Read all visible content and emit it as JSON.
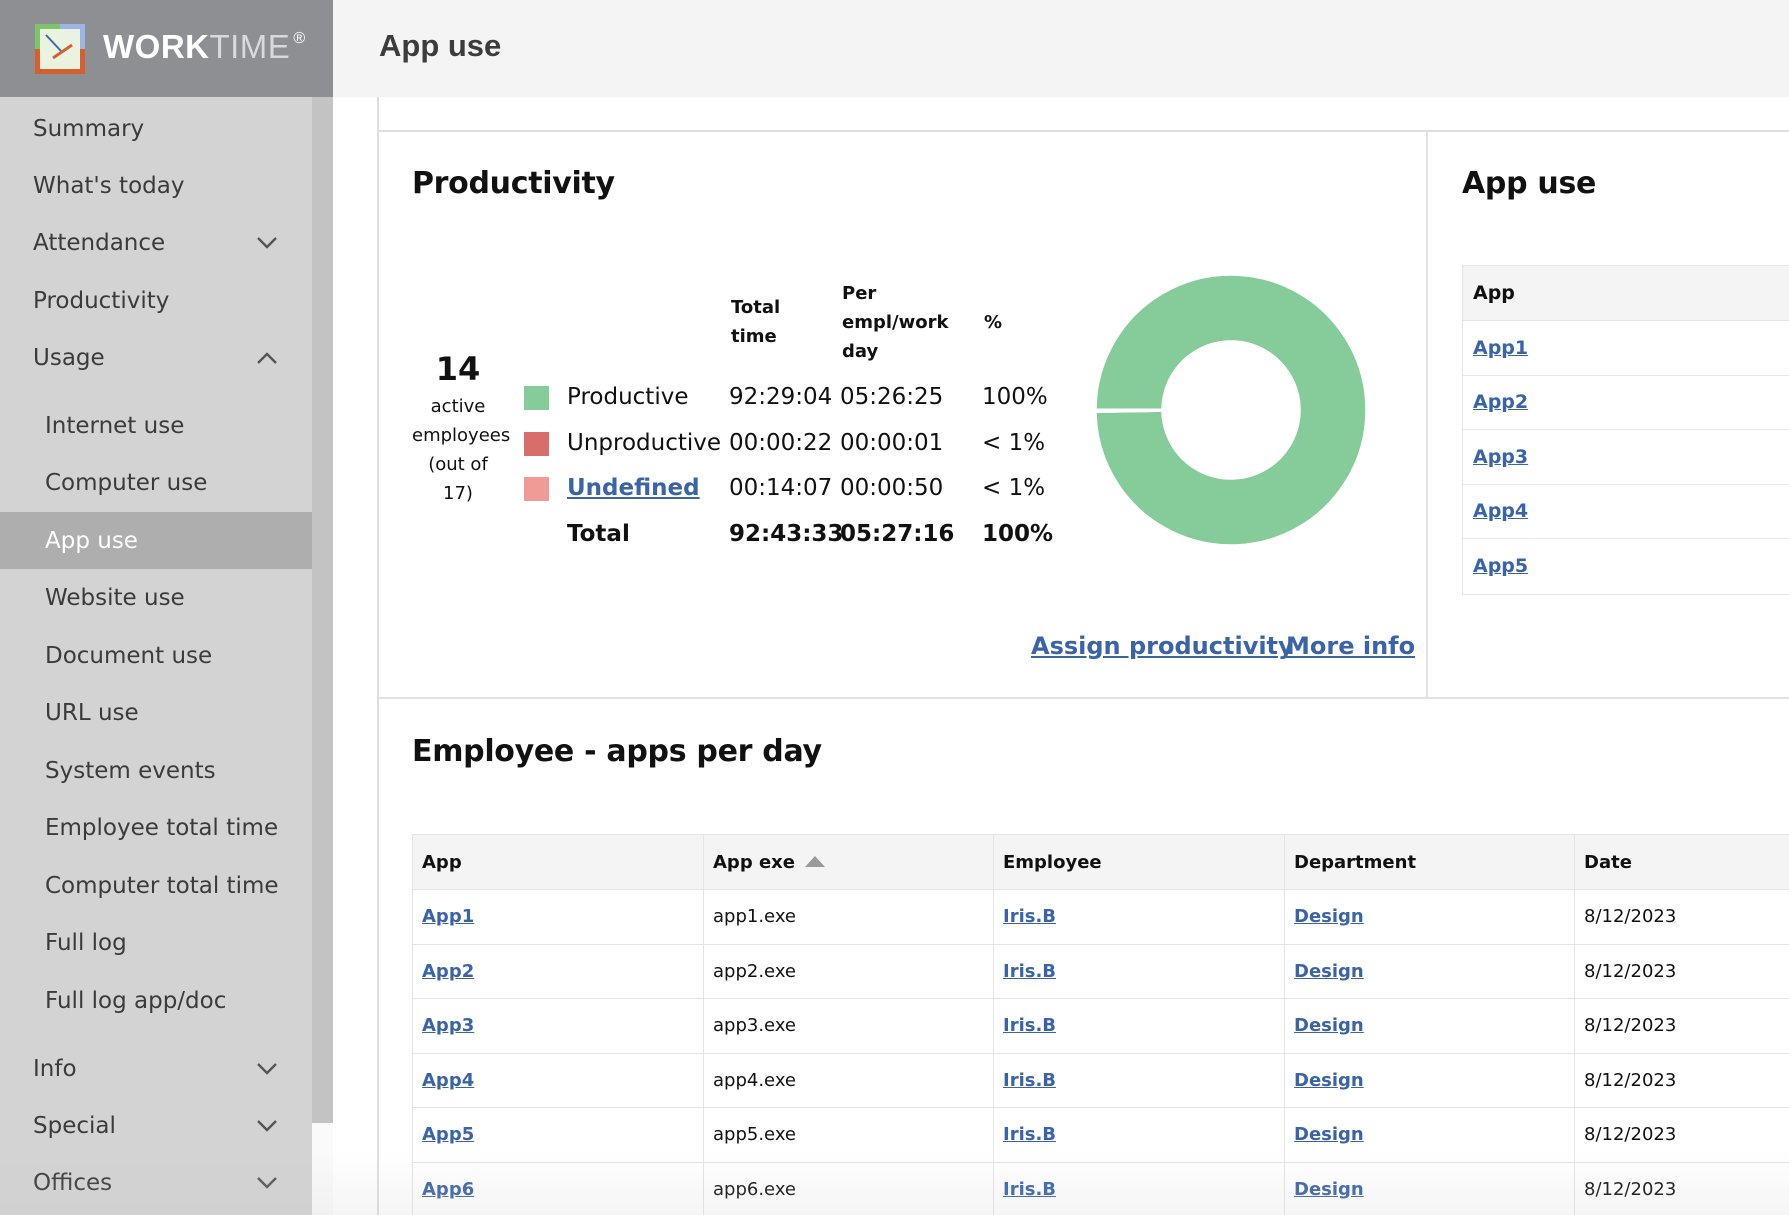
{
  "brand": {
    "name_bold": "WORK",
    "name_light": "TIME",
    "registered": "®",
    "logo_icon": "clock-logo-icon"
  },
  "header": {
    "title": "App use"
  },
  "sidebar": {
    "items": [
      {
        "label": "Summary",
        "level": "top"
      },
      {
        "label": "What's today",
        "level": "top"
      },
      {
        "label": "Attendance",
        "level": "top",
        "chevron": "down"
      },
      {
        "label": "Productivity",
        "level": "top"
      },
      {
        "label": "Usage",
        "level": "top",
        "chevron": "up"
      },
      {
        "label": "Internet use",
        "level": "sub"
      },
      {
        "label": "Computer use",
        "level": "sub"
      },
      {
        "label": "App use",
        "level": "sub",
        "active": true
      },
      {
        "label": "Website use",
        "level": "sub"
      },
      {
        "label": "Document use",
        "level": "sub"
      },
      {
        "label": "URL use",
        "level": "sub"
      },
      {
        "label": "System events",
        "level": "sub"
      },
      {
        "label": "Employee total time",
        "level": "sub"
      },
      {
        "label": "Computer total time",
        "level": "sub"
      },
      {
        "label": "Full log",
        "level": "sub"
      },
      {
        "label": "Full log app/doc",
        "level": "sub"
      },
      {
        "label": "Info",
        "level": "top",
        "chevron": "down"
      },
      {
        "label": "Special",
        "level": "top",
        "chevron": "down"
      },
      {
        "label": "Offices",
        "level": "top",
        "chevron": "down"
      }
    ]
  },
  "productivity": {
    "title": "Productivity",
    "active_employees": {
      "count": "14",
      "label_line1": "active",
      "label_line2": "employees",
      "label_line3": "(out of 17)"
    },
    "columns": {
      "total_line1": "Total",
      "total_line2": "time",
      "per_line1": "Per",
      "per_line2": "empl/work",
      "per_line3": "day",
      "pct": "%"
    },
    "rows": [
      {
        "label": "Productive",
        "color": "#86cb9a",
        "total": "92:29:04",
        "per": "05:26:25",
        "pct": "100%",
        "link": false
      },
      {
        "label": "Unproductive",
        "color": "#d86d6a",
        "total": "00:00:22",
        "per": "00:00:01",
        "pct": "< 1%",
        "link": false
      },
      {
        "label": "Undefined",
        "color": "#f09b96",
        "total": "00:14:07",
        "per": "00:00:50",
        "pct": "< 1%",
        "link": true
      }
    ],
    "total": {
      "label": "Total",
      "total": "92:43:33",
      "per": "05:27:16",
      "pct": "100%"
    },
    "assign_link": "Assign productivity",
    "more_info_link": "More info"
  },
  "chart_data": {
    "type": "pie",
    "style": "donut",
    "title": "",
    "categories": [
      "Productive",
      "Unproductive",
      "Undefined"
    ],
    "values": [
      332944,
      22,
      847
    ],
    "units": "seconds",
    "colors": [
      "#86cb9a",
      "#d86d6a",
      "#f09b96"
    ],
    "legend": "left (table)"
  },
  "app_use": {
    "title": "App use",
    "header": "App",
    "rows": [
      "App1",
      "App2",
      "App3",
      "App4",
      "App5"
    ]
  },
  "employee_apps": {
    "title": "Employee - apps per day",
    "columns": [
      "App",
      "App exe",
      "Employee",
      "Department",
      "Date"
    ],
    "sorted_column": "App exe",
    "sort_direction": "ascending",
    "rows": [
      {
        "app": "App1",
        "exe": "app1.exe",
        "employee": "Iris.B",
        "department": "Design",
        "date": "8/12/2023"
      },
      {
        "app": "App2",
        "exe": "app2.exe",
        "employee": "Iris.B",
        "department": "Design",
        "date": "8/12/2023"
      },
      {
        "app": "App3",
        "exe": "app3.exe",
        "employee": "Iris.B",
        "department": "Design",
        "date": "8/12/2023"
      },
      {
        "app": "App4",
        "exe": "app4.exe",
        "employee": "Iris.B",
        "department": "Design",
        "date": "8/12/2023"
      },
      {
        "app": "App5",
        "exe": "app5.exe",
        "employee": "Iris.B",
        "department": "Design",
        "date": "8/12/2023"
      },
      {
        "app": "App6",
        "exe": "app6.exe",
        "employee": "Iris.B",
        "department": "Design",
        "date": "8/12/2023"
      }
    ]
  }
}
